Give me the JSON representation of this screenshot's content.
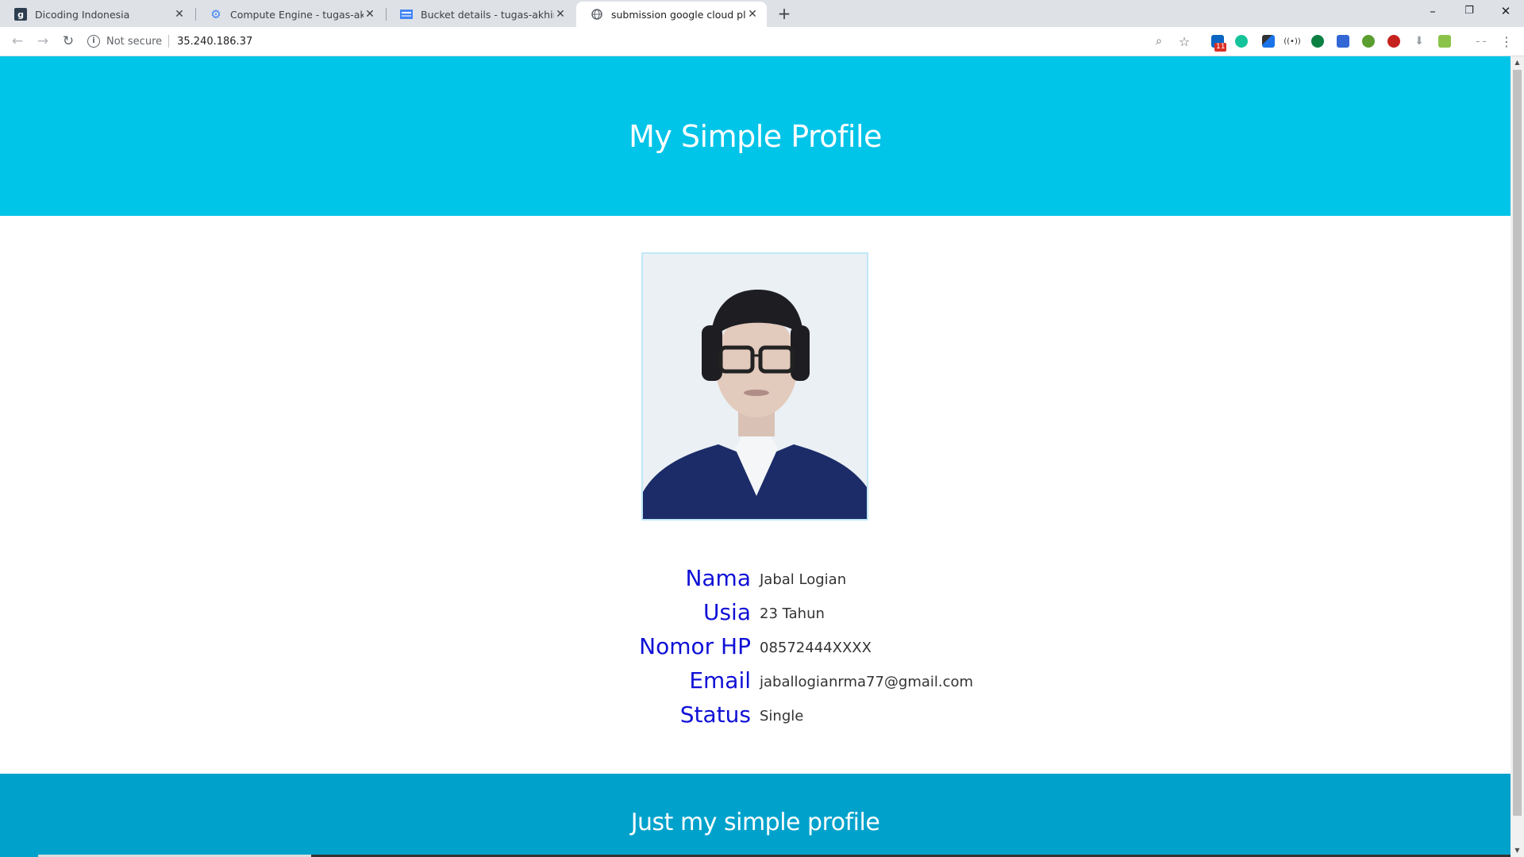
{
  "browser": {
    "tabs": [
      {
        "title": "Dicoding Indonesia",
        "icon": "dicoding-favicon"
      },
      {
        "title": "Compute Engine - tugas-akhir - (",
        "icon": "compute-engine-favicon"
      },
      {
        "title": "Bucket details - tugas-akhir - Goo",
        "icon": "cloud-storage-favicon"
      },
      {
        "title": "submission google cloud platform",
        "icon": "globe-favicon"
      }
    ],
    "active_tab": 3,
    "security_label": "Not secure",
    "url": "35.240.186.37",
    "extension_badge": "11"
  },
  "page": {
    "header_title": "My Simple Profile",
    "profile": [
      {
        "label": "Nama",
        "value": "Jabal Logian"
      },
      {
        "label": "Usia",
        "value": "23 Tahun"
      },
      {
        "label": "Nomor HP",
        "value": "08572444XXXX"
      },
      {
        "label": "Email",
        "value": "jaballogianrma77@gmail.com"
      },
      {
        "label": "Status",
        "value": "Single"
      }
    ],
    "footer_text": "Just my simple profile"
  },
  "colors": {
    "header_bg": "#00c4e8",
    "footer_bg": "#00a2cc",
    "label": "#1010d6"
  }
}
